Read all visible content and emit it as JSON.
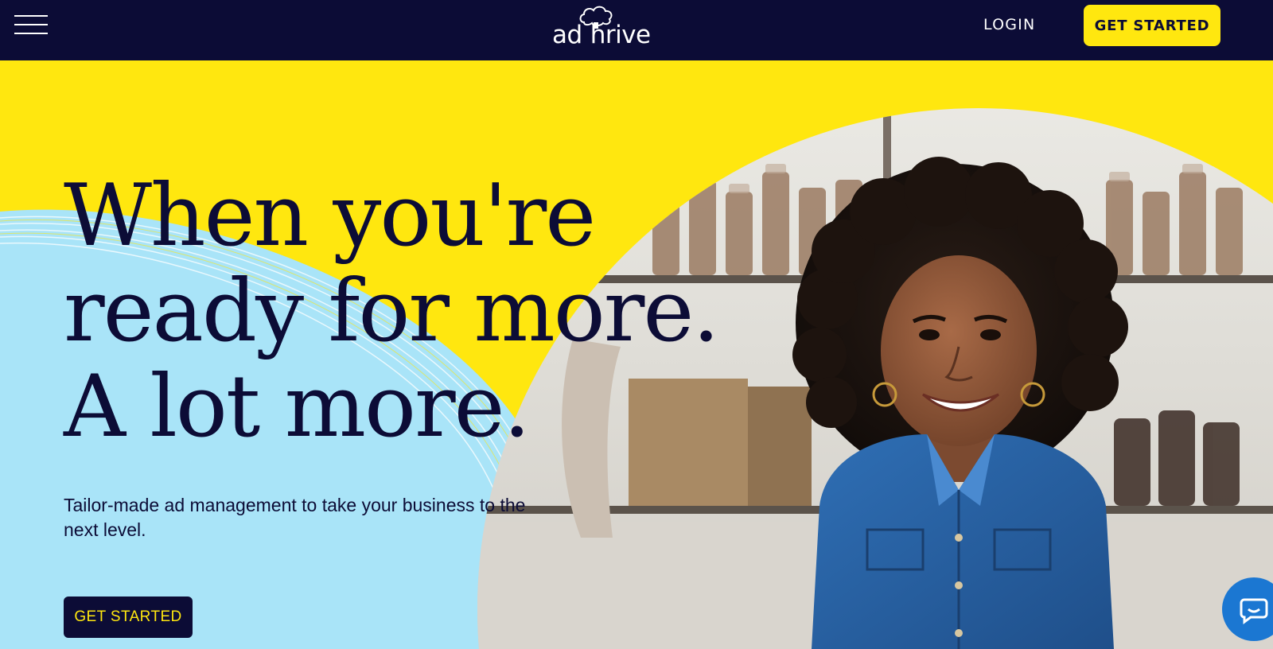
{
  "header": {
    "logo_text": "ad thrive",
    "login_label": "LOGIN",
    "cta_label": "GET STARTED",
    "menu_icon": "hamburger-menu-icon",
    "logo_icon": "tree-icon"
  },
  "hero": {
    "headline_lines": [
      "When you're",
      "ready for more.",
      "A lot more."
    ],
    "subtext": "Tailor-made ad management to take your business to the next level.",
    "cta_label": "GET STARTED",
    "chat_icon": "chat-icon"
  },
  "colors": {
    "navy": "#0c0c36",
    "yellow": "#ffe70f",
    "light_blue": "#a9e4f8",
    "chat_blue": "#1b77d2"
  }
}
